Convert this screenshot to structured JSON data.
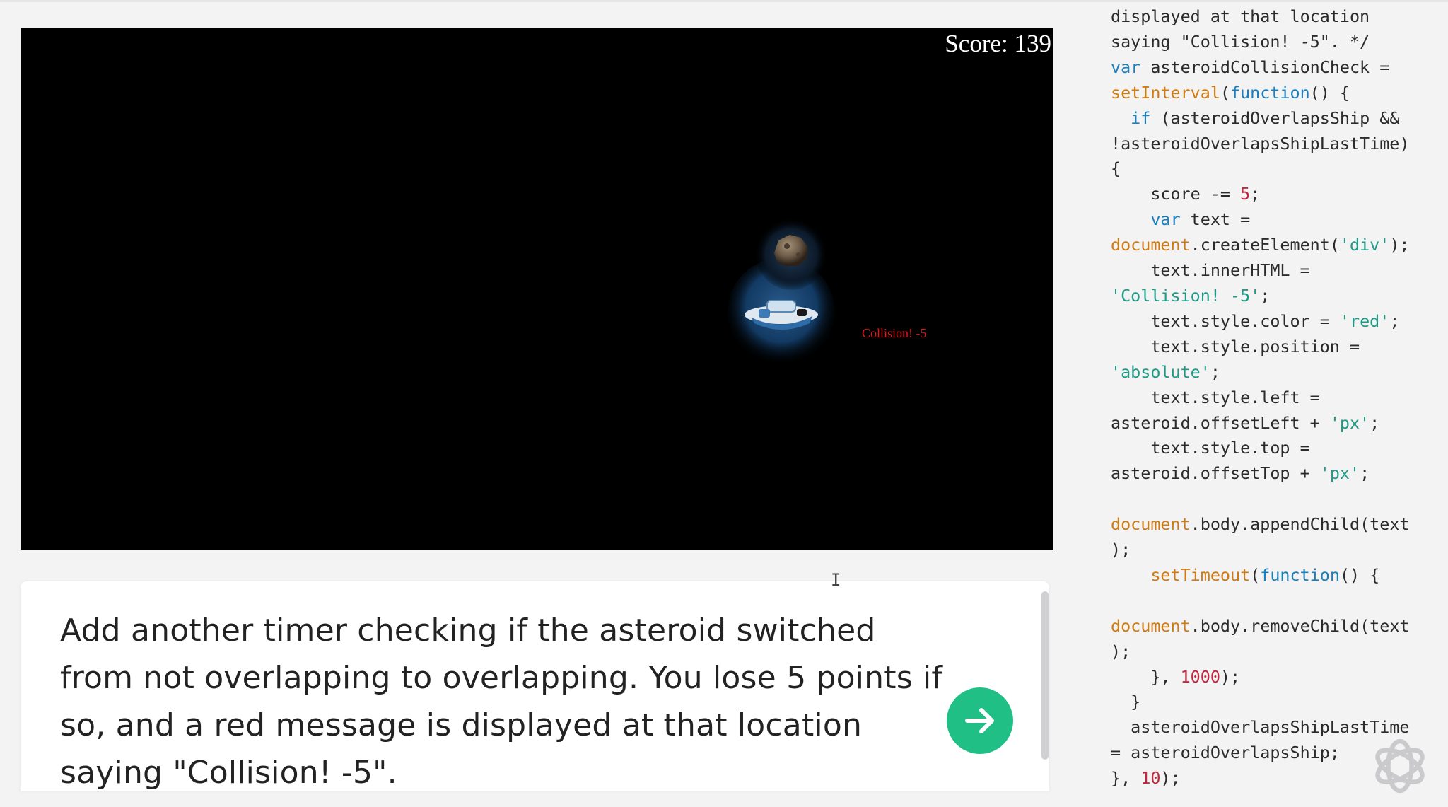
{
  "game": {
    "score_text": "Score: 139",
    "collision_text": "Collision! -5"
  },
  "prompt": {
    "text": "Add another timer checking if the asteroid switched from not overlapping to overlapping. You lose 5 points if so, and a red message is displayed at that location saying \"Collision! -5\"."
  },
  "icons": {
    "submit": "arrow-right-icon",
    "logo": "openai-logo-icon",
    "cursor": "text-cursor-icon"
  },
  "colors": {
    "submit_button": "#1fbf85",
    "collision_text": "#e01818",
    "code_keyword": "#1a7fbd",
    "code_function": "#d07a12",
    "code_string": "#1f9a86",
    "code_number": "#c0273d"
  },
  "code": {
    "lines": [
      [
        {
          "t": "displayed at that location"
        }
      ],
      [
        {
          "t": "saying \"Collision! -5\". */"
        }
      ],
      [
        {
          "t": "var",
          "c": "kw"
        },
        {
          "t": " asteroidCollisionCheck ="
        }
      ],
      [
        {
          "t": "setInterval",
          "c": "fn"
        },
        {
          "t": "("
        },
        {
          "t": "function",
          "c": "kw"
        },
        {
          "t": "() {"
        }
      ],
      [
        {
          "t": "  "
        },
        {
          "t": "if",
          "c": "kw"
        },
        {
          "t": " (asteroidOverlapsShip &&"
        }
      ],
      [
        {
          "t": "!asteroidOverlapsShipLastTime)"
        }
      ],
      [
        {
          "t": "{"
        }
      ],
      [
        {
          "t": "    score -= "
        },
        {
          "t": "5",
          "c": "num"
        },
        {
          "t": ";"
        }
      ],
      [
        {
          "t": "    "
        },
        {
          "t": "var",
          "c": "kw"
        },
        {
          "t": " text ="
        }
      ],
      [
        {
          "t": "document",
          "c": "fn"
        },
        {
          "t": ".createElement("
        },
        {
          "t": "'div'",
          "c": "str"
        },
        {
          "t": ");"
        }
      ],
      [
        {
          "t": "    text.innerHTML ="
        }
      ],
      [
        {
          "t": "'Collision! -5'",
          "c": "str"
        },
        {
          "t": ";"
        }
      ],
      [
        {
          "t": "    text.style.color = "
        },
        {
          "t": "'red'",
          "c": "str"
        },
        {
          "t": ";"
        }
      ],
      [
        {
          "t": "    text.style.position ="
        }
      ],
      [
        {
          "t": "'absolute'",
          "c": "str"
        },
        {
          "t": ";"
        }
      ],
      [
        {
          "t": "    text.style.left ="
        }
      ],
      [
        {
          "t": "asteroid.offsetLeft + "
        },
        {
          "t": "'px'",
          "c": "str"
        },
        {
          "t": ";"
        }
      ],
      [
        {
          "t": "    text.style.top ="
        }
      ],
      [
        {
          "t": "asteroid.offsetTop + "
        },
        {
          "t": "'px'",
          "c": "str"
        },
        {
          "t": ";"
        }
      ],
      [
        {
          "t": ""
        }
      ],
      [
        {
          "t": "document",
          "c": "fn"
        },
        {
          "t": ".body.appendChild(text"
        }
      ],
      [
        {
          "t": ");"
        }
      ],
      [
        {
          "t": "    "
        },
        {
          "t": "setTimeout",
          "c": "fn"
        },
        {
          "t": "("
        },
        {
          "t": "function",
          "c": "kw"
        },
        {
          "t": "() {"
        }
      ],
      [
        {
          "t": ""
        }
      ],
      [
        {
          "t": "document",
          "c": "fn"
        },
        {
          "t": ".body.removeChild(text"
        }
      ],
      [
        {
          "t": ");"
        }
      ],
      [
        {
          "t": "    }, "
        },
        {
          "t": "1000",
          "c": "num"
        },
        {
          "t": ");"
        }
      ],
      [
        {
          "t": "  }"
        }
      ],
      [
        {
          "t": "  asteroidOverlapsShipLastTime"
        }
      ],
      [
        {
          "t": "= asteroidOverlapsShip;"
        }
      ],
      [
        {
          "t": "}, "
        },
        {
          "t": "10",
          "c": "num"
        },
        {
          "t": ");"
        }
      ]
    ]
  }
}
